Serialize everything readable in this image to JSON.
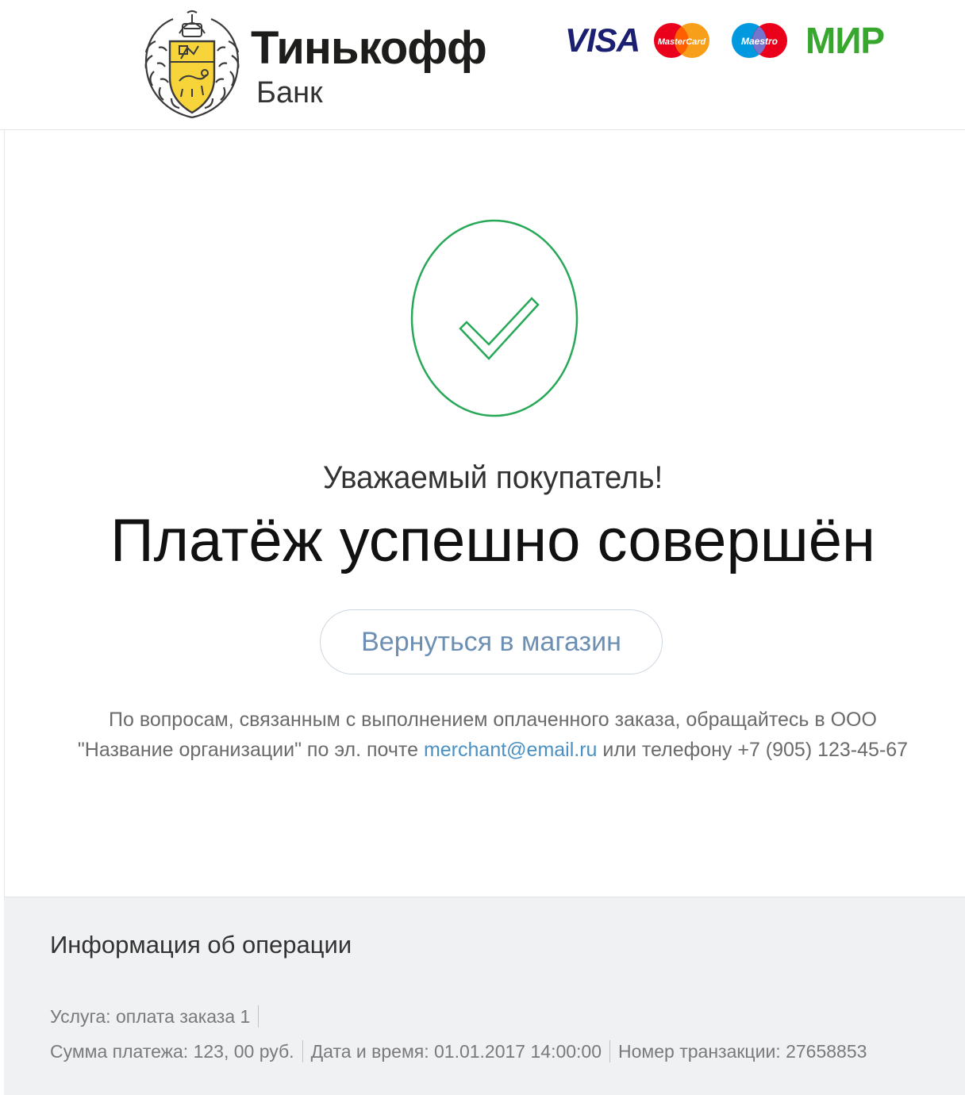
{
  "header": {
    "bank_name": "Тинькофф",
    "bank_subtitle": "Банк",
    "brands": {
      "visa": "VISA",
      "mastercard": "MasterCard",
      "maestro": "Maestro",
      "mir": "МИР"
    }
  },
  "status": {
    "icon": "checkmark-icon",
    "greeting": "Уважаемый покупатель!",
    "headline": "Платёж успешно совершён",
    "success_color": "#27a857"
  },
  "return_button": {
    "label": "Вернуться в магазин"
  },
  "contact": {
    "text_part1": "По вопросам, связанным с выполнением оплаченного заказа, обращайтесь в ООО",
    "text_part2": "\"Название организации\" по эл. почте",
    "email": "merchant@email.ru",
    "text_part3": "или телефону +7 (905) 123-45-67"
  },
  "operation_info": {
    "title": "Информация об операции",
    "service": "Услуга: оплата заказа 1",
    "amount": "Сумма платежа: 123, 00 руб.",
    "datetime": "Дата и время: 01.01.2017 14:00:00",
    "transaction": "Номер транзакции: 27658853"
  },
  "colors": {
    "link": "#4a90c2",
    "button_text": "#6d8fb3",
    "info_background": "#f0f1f3",
    "visa": "#1a1f71",
    "mir": "#37a72e"
  }
}
